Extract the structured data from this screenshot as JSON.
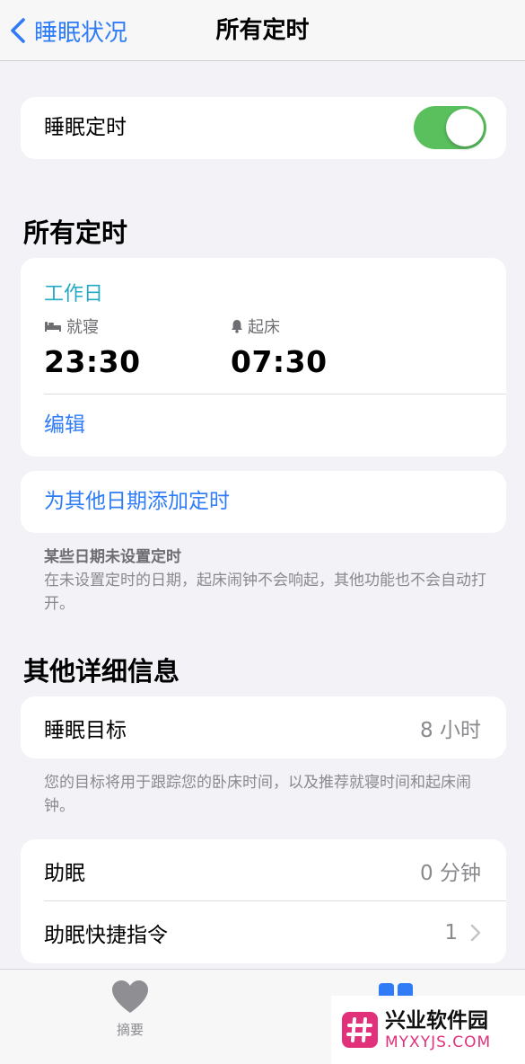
{
  "nav": {
    "back_label": "睡眠状况",
    "title": "所有定时"
  },
  "sleep_schedule": {
    "label": "睡眠定时",
    "enabled": true
  },
  "all_schedules": {
    "section_title": "所有定时",
    "schedule": {
      "days": "工作日",
      "bedtime_label": "就寝",
      "bedtime": "23:30",
      "wake_label": "起床",
      "wake_time": "07:30",
      "edit_label": "编辑"
    },
    "add_label": "为其他日期添加定时",
    "note_title": "某些日期未设置定时",
    "note_body": "在未设置定时的日期，起床闹钟不会响起，其他功能也不会自动打开。"
  },
  "other_details": {
    "section_title": "其他详细信息",
    "sleep_goal_label": "睡眠目标",
    "sleep_goal_value": "8 小时",
    "goal_note": "您的目标将用于跟踪您的卧床时间，以及推荐就寝时间和起床闹钟。",
    "wind_down_label": "助眠",
    "wind_down_value": "0 分钟",
    "shortcuts_label": "助眠快捷指令",
    "shortcuts_value": "1"
  },
  "tabbar": {
    "summary_label": "摘要",
    "summary_icon": "heart-icon",
    "browse_icon": "grid-icon"
  },
  "watermark": {
    "name": "兴业软件园",
    "url": "MYXYJS.COM"
  },
  "colors": {
    "accent_blue": "#2f7cf6",
    "toggle_green": "#5ac05e",
    "days_teal": "#23a9c6",
    "watermark_pink": "#e0317a"
  }
}
